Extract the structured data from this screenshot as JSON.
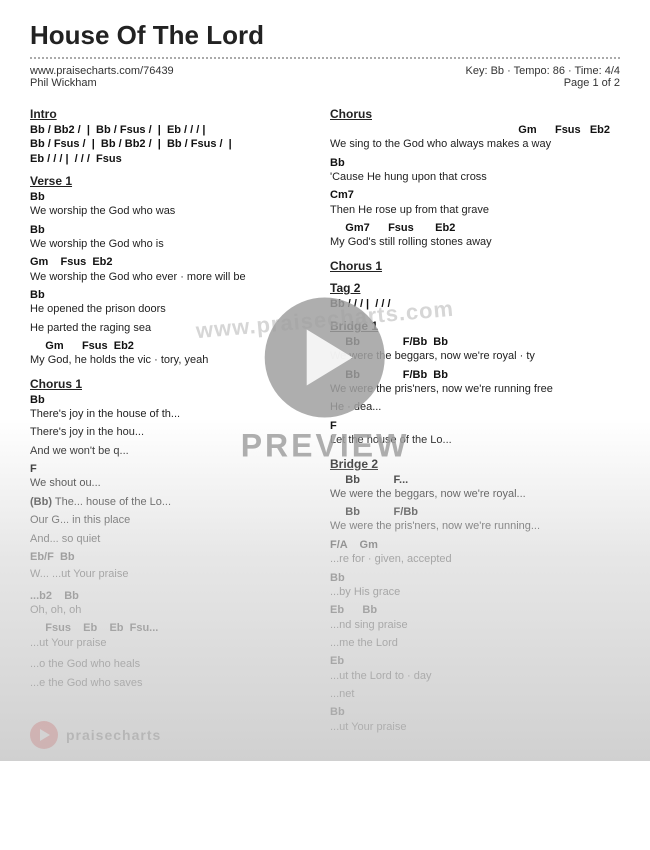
{
  "title": "House Of The Lord",
  "url": "www.praisecharts.com/76439",
  "author": "Phil Wickham",
  "key": "Key: Bb",
  "tempo": "Tempo: 86",
  "time": "Time: 4/4",
  "page": "Page 1 of 2",
  "sections": {
    "intro": {
      "label": "Intro",
      "lines": [
        "Bb / Bb2 /  |  Bb / Fsus /  |  Eb / / / |",
        "Bb / Fsus /  |  Bb / Bb2 /  |  Bb / Fsus /  |",
        "Eb / / / |  / / /  Fsus"
      ]
    },
    "verse1": {
      "label": "Verse 1",
      "blocks": [
        {
          "chord": "Bb",
          "lyric": "We worship the God who was"
        },
        {
          "chord": "Bb",
          "lyric": "We worship the God who is"
        },
        {
          "chord": "Gm    Fsus  Eb2",
          "lyric": "We worship the God who ever · more will be"
        },
        {
          "chord": "Bb",
          "lyric": "He opened the prison doors"
        },
        {
          "chord": "",
          "lyric": "He parted the raging sea"
        },
        {
          "chord": "Gm      Fsus  Eb2",
          "lyric": "My God, he holds the vic · tory, yeah"
        }
      ]
    },
    "chorus1_left": {
      "label": "Chorus 1",
      "blocks": [
        {
          "chord": "Bb",
          "lyric": "There's joy in the house of th..."
        },
        {
          "chord": "",
          "lyric": "There's joy in the hou..."
        },
        {
          "chord": "",
          "lyric": "And we won't be q..."
        },
        {
          "chord": "F",
          "lyric": "We shout ou..."
        },
        {
          "chord": "(Bb)",
          "lyric": "The...    house of the Lo..."
        },
        {
          "chord": "",
          "lyric": "Our G...   in this place"
        },
        {
          "chord": "",
          "lyric": "And...  so quiet"
        },
        {
          "chord": "Eb/F  Bb",
          "lyric": ""
        },
        {
          "chord": "W...",
          "lyric": "...ut Your praise"
        }
      ]
    },
    "tag": {
      "label": "Tag 2",
      "lines": [
        "Bb / / / |  / / /"
      ]
    },
    "right_col": {
      "chorus_right": {
        "label": "Chorus",
        "blocks": [
          {
            "chord": "Gm      Fsus   Eb2",
            "lyric": "We sing to the God who always makes  a  way"
          },
          {
            "chord": "Bb",
            "lyric": "'Cause He hung upon that cross"
          },
          {
            "chord": "Cm7",
            "lyric": "Then He rose up from that grave"
          },
          {
            "chord": "Gm7      Fsus       Eb2",
            "lyric": "My God's still rolling stones away"
          }
        ]
      },
      "chorus1_right": {
        "label": "Chorus 1"
      },
      "bridge1": {
        "label": "Bridge 1",
        "blocks": [
          {
            "chord": "Bb              F/Bb  Bb",
            "lyric": "We were the beggars, now we're royal · ty"
          },
          {
            "chord": "Bb              F/Bb  Bb",
            "lyric": "We were the pris'ners, now we're running free"
          },
          {
            "chord": "",
            "lyric": "He · dea..."
          },
          {
            "chord": "F",
            "lyric": "Let the house of the Lo..."
          }
        ]
      },
      "bridge2": {
        "label": "Bridge 2",
        "blocks": [
          {
            "chord": "Bb           F...",
            "lyric": "We were the beggars, now we're royal..."
          },
          {
            "chord": "Bb           F/Bb",
            "lyric": "We were the pris'ners, now we're running..."
          },
          {
            "chord": "F/A    Gm",
            "lyric": "...re for · given, accepted"
          },
          {
            "chord": "Bb",
            "lyric": "...by His grace"
          },
          {
            "chord": "Eb      Bb",
            "lyric": "...nd sing praise"
          },
          {
            "chord": "",
            "lyric": "...me the Lord"
          },
          {
            "chord": "Eb",
            "lyric": "...ut the Lord to · day"
          },
          {
            "chord": "",
            "lyric": "...net"
          },
          {
            "chord": "Bb",
            "lyric": "...ut Your praise"
          }
        ]
      }
    }
  },
  "footer": {
    "brand": "praisecharts",
    "preview_label": "PREVIEW"
  }
}
